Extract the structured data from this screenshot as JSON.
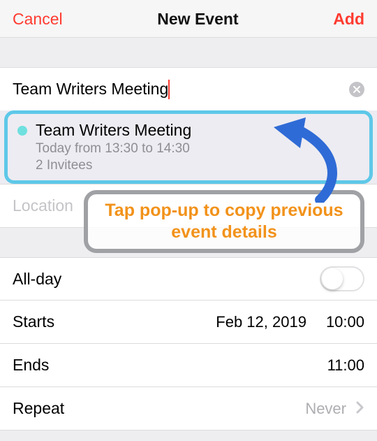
{
  "header": {
    "cancel": "Cancel",
    "title": "New Event",
    "add": "Add"
  },
  "form": {
    "title_value": "Team Writers Meeting",
    "location_placeholder": "Location"
  },
  "suggestion": {
    "title": "Team Writers Meeting",
    "time": "Today from 13:30 to 14:30",
    "invitees": "2 Invitees"
  },
  "annotation": {
    "text": "Tap pop-up to copy previous event details"
  },
  "allday": {
    "label": "All-day",
    "on": false
  },
  "starts": {
    "label": "Starts",
    "date": "Feb 12, 2019",
    "time": "10:00"
  },
  "ends": {
    "label": "Ends",
    "time": "11:00"
  },
  "repeat": {
    "label": "Repeat",
    "value": "Never"
  }
}
